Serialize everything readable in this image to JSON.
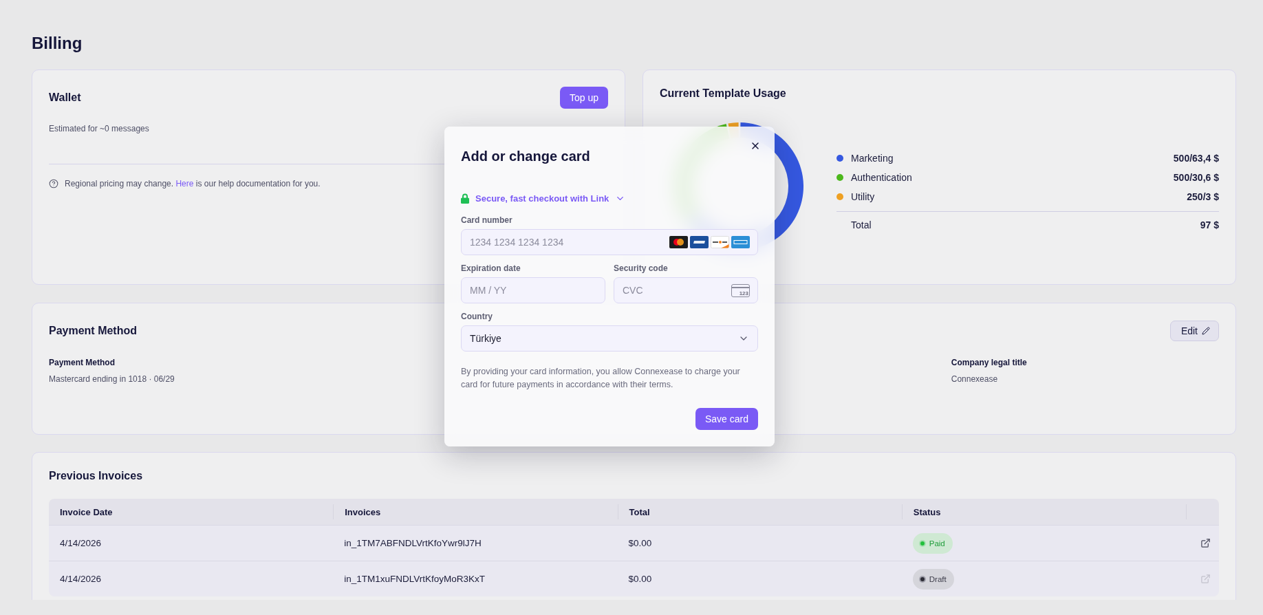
{
  "page": {
    "title": "Billing"
  },
  "wallet": {
    "title": "Wallet",
    "top_up_button": "Top up",
    "estimate": "Estimated for ~0 messages",
    "help": {
      "before": "Regional pricing may change.",
      "link": "Here",
      "after": "is our help documentation for you."
    }
  },
  "template_usage": {
    "title": "Current Template Usage",
    "chart_data": {
      "type": "donut",
      "legend": "right",
      "categories": [
        "Marketing",
        "Authentication",
        "Utility"
      ],
      "values": [
        65.36,
        31.55,
        3.09
      ]
    },
    "legend": [
      {
        "color": "#3558e0",
        "amount": "500/63,4 $"
      },
      {
        "color": "#4cb81c",
        "amount": "500/30,6 $"
      },
      {
        "color": "#eea022",
        "amount": "250/3 $"
      }
    ],
    "total": {
      "label": "Total",
      "amount": "97 $"
    }
  },
  "payment_method": {
    "title": "Payment Method",
    "edit_button": "Edit",
    "fields": [
      {
        "label": "Payment Method",
        "value": "Mastercard ending in 1018 · 06/29"
      },
      {
        "label": "Company legal title",
        "value": "Connexease"
      }
    ]
  },
  "invoices": {
    "title": "Previous Invoices",
    "columns": [
      "Invoice Date",
      "Invoices",
      "Total",
      "Status"
    ],
    "rows": [
      {
        "date": "4/14/2026",
        "invoice": "in_1TM7ABFNDLVrtKfoYwr9lJ7H",
        "total": "$0.00",
        "status": {
          "label": "Paid",
          "kind": "paid"
        },
        "link_disabled": false
      },
      {
        "date": "4/14/2026",
        "invoice": "in_1TM1xuFNDLVrtKfoyMoR3KxT",
        "total": "$0.00",
        "status": {
          "label": "Draft",
          "kind": "draft"
        },
        "link_disabled": true
      }
    ]
  },
  "card_dialog": {
    "title": "Add or change card",
    "link_checkout": "Secure, fast checkout with Link",
    "card_number": {
      "label": "Card number",
      "placeholder": "1234 1234 1234 1234"
    },
    "expiration": {
      "label": "Expiration date",
      "placeholder": "MM / YY"
    },
    "security_code": {
      "label": "Security code",
      "placeholder": "CVC",
      "icon_text": "123"
    },
    "country": {
      "label": "Country",
      "value": "Türkiye"
    },
    "terms": "By providing your card information, you allow Connexease to charge your card for future payments in accordance with their terms.",
    "save_button": "Save card"
  }
}
